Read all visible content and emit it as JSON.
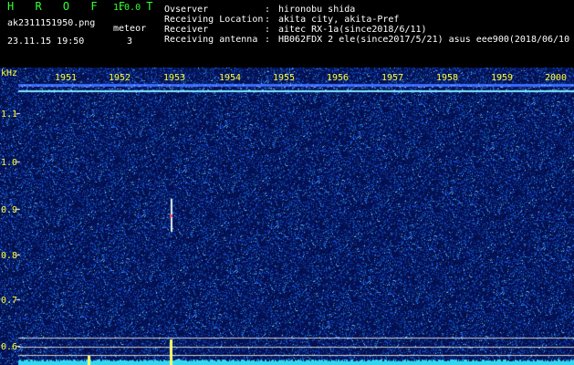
{
  "header": {
    "title": "H R O F F T",
    "version": "1.0.0",
    "filename": "ak2311151950.png",
    "meteor_label": "meteor",
    "meteor_count": "3",
    "datetime": "23.11.15 19:50"
  },
  "observer_info": [
    {
      "label": "Ovserver",
      "value": "hironobu shida"
    },
    {
      "label": "Receiving Location",
      "value": "akita city, akita-Pref"
    },
    {
      "label": "Receiver",
      "value": "aitec RX-1a(since2018/6/11)"
    },
    {
      "label": "Receiving antenna",
      "value": "HB062FDX 2 ele(since2017/5/21)  asus eee900(2018/06/10"
    }
  ],
  "plot": {
    "y_unit": "kHz",
    "y_ticks": [
      "1.1",
      "1.0",
      "0.9",
      "0.8",
      "0.7",
      "0.6"
    ],
    "x_ticks": [
      "1951",
      "1952",
      "1953",
      "1954",
      "1955",
      "1956",
      "1957",
      "1958",
      "1959",
      "2000"
    ],
    "background_color": "#050a5a",
    "noise_color": "#2a4fd6",
    "signal_color": "#7fe8ff",
    "meteor_color": "#ffff66"
  }
}
